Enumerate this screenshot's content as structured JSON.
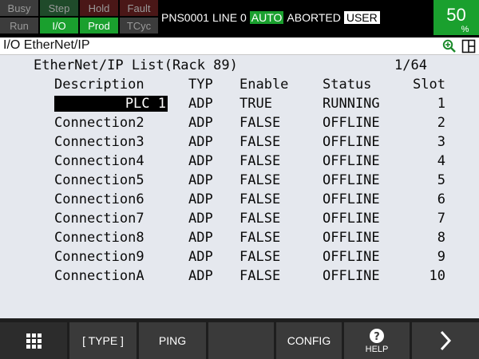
{
  "lamps": {
    "busy": "Busy",
    "step": "Step",
    "hold": "Hold",
    "fault": "Fault",
    "run": "Run",
    "io": "I/O",
    "prod": "Prod",
    "tcyc": "TCyc"
  },
  "status": {
    "program": "PNS0001",
    "line": "LINE 0",
    "mode": "AUTO",
    "state": "ABORTED",
    "user": "USER"
  },
  "override": {
    "value": "50",
    "unit": "%"
  },
  "screen_title": "I/O EtherNet/IP",
  "list": {
    "title": "EtherNet/IP List(Rack 89)",
    "page": "1/64",
    "headers": {
      "description": "Description",
      "typ": "TYP",
      "enable": "Enable",
      "status": "Status",
      "slot": "Slot"
    },
    "rows": [
      {
        "description": "PLC 1",
        "typ": "ADP",
        "enable": "TRUE",
        "status": "RUNNING",
        "slot": "1"
      },
      {
        "description": "Connection2",
        "typ": "ADP",
        "enable": "FALSE",
        "status": "OFFLINE",
        "slot": "2"
      },
      {
        "description": "Connection3",
        "typ": "ADP",
        "enable": "FALSE",
        "status": "OFFLINE",
        "slot": "3"
      },
      {
        "description": "Connection4",
        "typ": "ADP",
        "enable": "FALSE",
        "status": "OFFLINE",
        "slot": "4"
      },
      {
        "description": "Connection5",
        "typ": "ADP",
        "enable": "FALSE",
        "status": "OFFLINE",
        "slot": "5"
      },
      {
        "description": "Connection6",
        "typ": "ADP",
        "enable": "FALSE",
        "status": "OFFLINE",
        "slot": "6"
      },
      {
        "description": "Connection7",
        "typ": "ADP",
        "enable": "FALSE",
        "status": "OFFLINE",
        "slot": "7"
      },
      {
        "description": "Connection8",
        "typ": "ADP",
        "enable": "FALSE",
        "status": "OFFLINE",
        "slot": "8"
      },
      {
        "description": "Connection9",
        "typ": "ADP",
        "enable": "FALSE",
        "status": "OFFLINE",
        "slot": "9"
      },
      {
        "description": "ConnectionA",
        "typ": "ADP",
        "enable": "FALSE",
        "status": "OFFLINE",
        "slot": "10"
      }
    ]
  },
  "softkeys": {
    "menu_icon": "grid-icon",
    "type": "[ TYPE ]",
    "ping": "PING",
    "blank": "",
    "config": "CONFIG",
    "help_icon": "question-icon",
    "help": "HELP",
    "next_icon": "chevron-right-icon"
  },
  "colors": {
    "active_green": "#1aa02e",
    "content_bg": "#e5e8ee"
  }
}
